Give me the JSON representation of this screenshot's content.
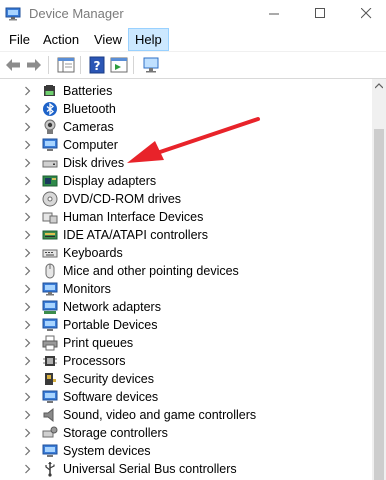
{
  "window": {
    "title": "Device Manager"
  },
  "menu": [
    {
      "label": "File"
    },
    {
      "label": "Action"
    },
    {
      "label": "View"
    },
    {
      "label": "Help"
    }
  ],
  "tree": {
    "items": [
      {
        "label": "Batteries",
        "icon": "battery-icon"
      },
      {
        "label": "Bluetooth",
        "icon": "bluetooth-icon"
      },
      {
        "label": "Cameras",
        "icon": "camera-icon"
      },
      {
        "label": "Computer",
        "icon": "computer-icon"
      },
      {
        "label": "Disk drives",
        "icon": "disk-drive-icon"
      },
      {
        "label": "Display adapters",
        "icon": "display-adapter-icon"
      },
      {
        "label": "DVD/CD-ROM drives",
        "icon": "dvd-drive-icon"
      },
      {
        "label": "Human Interface Devices",
        "icon": "hid-icon"
      },
      {
        "label": "IDE ATA/ATAPI controllers",
        "icon": "ide-controller-icon"
      },
      {
        "label": "Keyboards",
        "icon": "keyboard-icon"
      },
      {
        "label": "Mice and other pointing devices",
        "icon": "mouse-icon"
      },
      {
        "label": "Monitors",
        "icon": "monitor-icon"
      },
      {
        "label": "Network adapters",
        "icon": "network-adapter-icon"
      },
      {
        "label": "Portable Devices",
        "icon": "portable-device-icon"
      },
      {
        "label": "Print queues",
        "icon": "printer-icon"
      },
      {
        "label": "Processors",
        "icon": "processor-icon"
      },
      {
        "label": "Security devices",
        "icon": "security-device-icon"
      },
      {
        "label": "Software devices",
        "icon": "software-device-icon"
      },
      {
        "label": "Sound, video and game controllers",
        "icon": "speaker-icon"
      },
      {
        "label": "Storage controllers",
        "icon": "storage-controller-icon"
      },
      {
        "label": "System devices",
        "icon": "system-device-icon"
      },
      {
        "label": "Universal Serial Bus controllers",
        "icon": "usb-icon"
      }
    ]
  },
  "annotation": {
    "arrow_color": "#e8232a",
    "points_to": "Disk drives"
  }
}
